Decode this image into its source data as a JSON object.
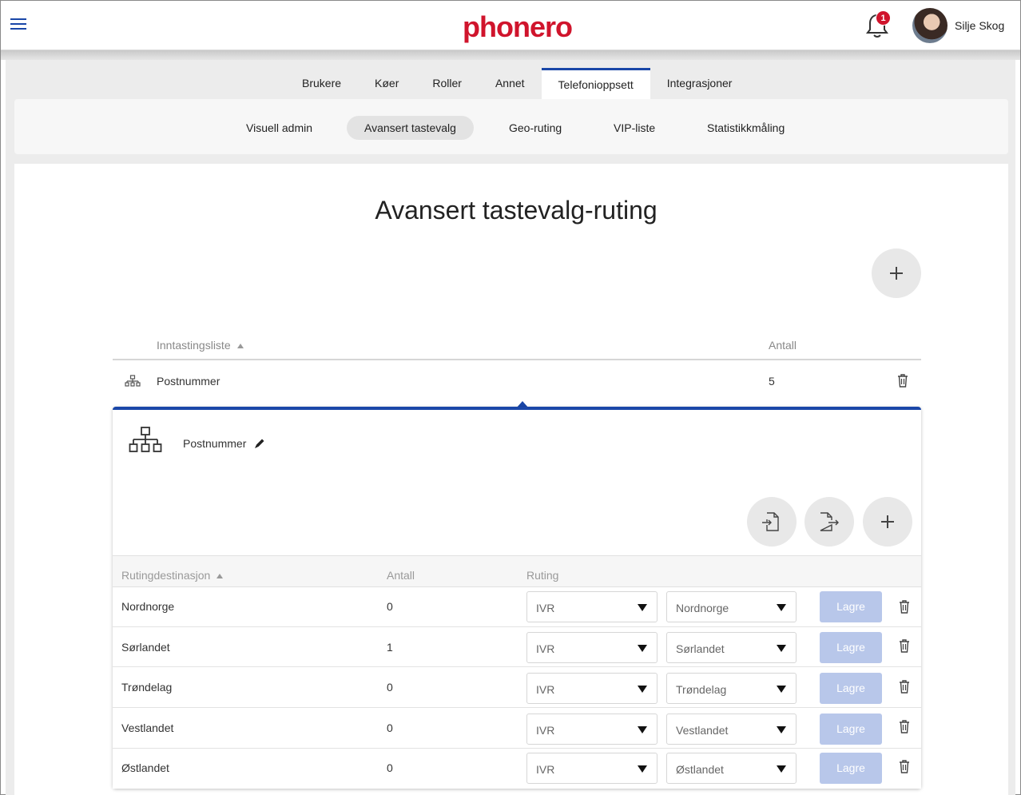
{
  "header": {
    "logo": "phonero",
    "notifications_count": "1",
    "user_name": "Silje Skog",
    "icons": [
      "menu-icon",
      "bell-icon",
      "avatar"
    ]
  },
  "tabs": [
    {
      "label": "Brukere"
    },
    {
      "label": "Køer"
    },
    {
      "label": "Roller"
    },
    {
      "label": "Annet"
    },
    {
      "label": "Telefonioppsett",
      "active": true
    },
    {
      "label": "Integrasjoner"
    }
  ],
  "subtabs": [
    {
      "label": "Visuell admin"
    },
    {
      "label": "Avansert tastevalg",
      "active": true
    },
    {
      "label": "Geo-ruting"
    },
    {
      "label": "VIP-liste"
    },
    {
      "label": "Statistikkmåling"
    }
  ],
  "page": {
    "title": "Avansert tastevalg-ruting"
  },
  "list": {
    "col_name": "Inntastingsliste",
    "col_count": "Antall",
    "rows": [
      {
        "name": "Postnummer",
        "count": "5"
      }
    ]
  },
  "detail": {
    "name": "Postnummer",
    "col_destination": "Rutingdestinasjon",
    "col_count": "Antall",
    "col_routing": "Ruting",
    "save_label": "Lagre",
    "rows": [
      {
        "destination": "Nordnorge",
        "count": "0",
        "type": "IVR",
        "target": "Nordnorge"
      },
      {
        "destination": "Sørlandet",
        "count": "1",
        "type": "IVR",
        "target": "Sørlandet"
      },
      {
        "destination": "Trøndelag",
        "count": "0",
        "type": "IVR",
        "target": "Trøndelag"
      },
      {
        "destination": "Vestlandet",
        "count": "0",
        "type": "IVR",
        "target": "Vestlandet"
      },
      {
        "destination": "Østlandet",
        "count": "0",
        "type": "IVR",
        "target": "Østlandet"
      }
    ]
  },
  "colors": {
    "brand_red": "#d0142c",
    "accent_blue": "#1a47a8",
    "save_disabled": "#b8c7ea"
  }
}
